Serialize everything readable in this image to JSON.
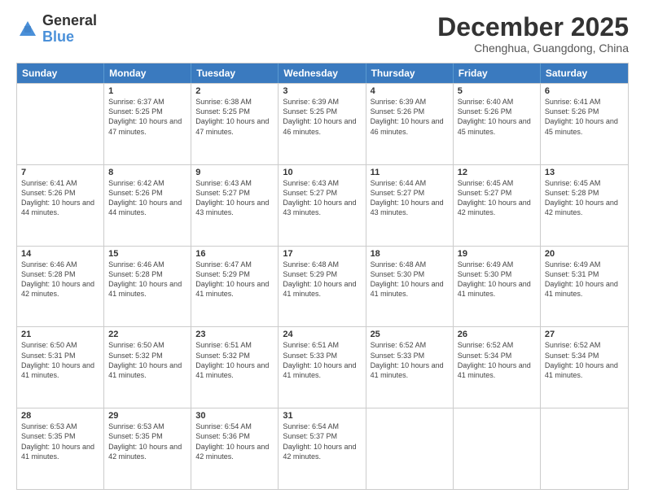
{
  "logo": {
    "general": "General",
    "blue": "Blue"
  },
  "title": "December 2025",
  "subtitle": "Chenghua, Guangdong, China",
  "header_days": [
    "Sunday",
    "Monday",
    "Tuesday",
    "Wednesday",
    "Thursday",
    "Friday",
    "Saturday"
  ],
  "weeks": [
    [
      {
        "day": "",
        "info": ""
      },
      {
        "day": "1",
        "info": "Sunrise: 6:37 AM\nSunset: 5:25 PM\nDaylight: 10 hours and 47 minutes."
      },
      {
        "day": "2",
        "info": "Sunrise: 6:38 AM\nSunset: 5:25 PM\nDaylight: 10 hours and 47 minutes."
      },
      {
        "day": "3",
        "info": "Sunrise: 6:39 AM\nSunset: 5:25 PM\nDaylight: 10 hours and 46 minutes."
      },
      {
        "day": "4",
        "info": "Sunrise: 6:39 AM\nSunset: 5:26 PM\nDaylight: 10 hours and 46 minutes."
      },
      {
        "day": "5",
        "info": "Sunrise: 6:40 AM\nSunset: 5:26 PM\nDaylight: 10 hours and 45 minutes."
      },
      {
        "day": "6",
        "info": "Sunrise: 6:41 AM\nSunset: 5:26 PM\nDaylight: 10 hours and 45 minutes."
      }
    ],
    [
      {
        "day": "7",
        "info": "Sunrise: 6:41 AM\nSunset: 5:26 PM\nDaylight: 10 hours and 44 minutes."
      },
      {
        "day": "8",
        "info": "Sunrise: 6:42 AM\nSunset: 5:26 PM\nDaylight: 10 hours and 44 minutes."
      },
      {
        "day": "9",
        "info": "Sunrise: 6:43 AM\nSunset: 5:27 PM\nDaylight: 10 hours and 43 minutes."
      },
      {
        "day": "10",
        "info": "Sunrise: 6:43 AM\nSunset: 5:27 PM\nDaylight: 10 hours and 43 minutes."
      },
      {
        "day": "11",
        "info": "Sunrise: 6:44 AM\nSunset: 5:27 PM\nDaylight: 10 hours and 43 minutes."
      },
      {
        "day": "12",
        "info": "Sunrise: 6:45 AM\nSunset: 5:27 PM\nDaylight: 10 hours and 42 minutes."
      },
      {
        "day": "13",
        "info": "Sunrise: 6:45 AM\nSunset: 5:28 PM\nDaylight: 10 hours and 42 minutes."
      }
    ],
    [
      {
        "day": "14",
        "info": "Sunrise: 6:46 AM\nSunset: 5:28 PM\nDaylight: 10 hours and 42 minutes."
      },
      {
        "day": "15",
        "info": "Sunrise: 6:46 AM\nSunset: 5:28 PM\nDaylight: 10 hours and 41 minutes."
      },
      {
        "day": "16",
        "info": "Sunrise: 6:47 AM\nSunset: 5:29 PM\nDaylight: 10 hours and 41 minutes."
      },
      {
        "day": "17",
        "info": "Sunrise: 6:48 AM\nSunset: 5:29 PM\nDaylight: 10 hours and 41 minutes."
      },
      {
        "day": "18",
        "info": "Sunrise: 6:48 AM\nSunset: 5:30 PM\nDaylight: 10 hours and 41 minutes."
      },
      {
        "day": "19",
        "info": "Sunrise: 6:49 AM\nSunset: 5:30 PM\nDaylight: 10 hours and 41 minutes."
      },
      {
        "day": "20",
        "info": "Sunrise: 6:49 AM\nSunset: 5:31 PM\nDaylight: 10 hours and 41 minutes."
      }
    ],
    [
      {
        "day": "21",
        "info": "Sunrise: 6:50 AM\nSunset: 5:31 PM\nDaylight: 10 hours and 41 minutes."
      },
      {
        "day": "22",
        "info": "Sunrise: 6:50 AM\nSunset: 5:32 PM\nDaylight: 10 hours and 41 minutes."
      },
      {
        "day": "23",
        "info": "Sunrise: 6:51 AM\nSunset: 5:32 PM\nDaylight: 10 hours and 41 minutes."
      },
      {
        "day": "24",
        "info": "Sunrise: 6:51 AM\nSunset: 5:33 PM\nDaylight: 10 hours and 41 minutes."
      },
      {
        "day": "25",
        "info": "Sunrise: 6:52 AM\nSunset: 5:33 PM\nDaylight: 10 hours and 41 minutes."
      },
      {
        "day": "26",
        "info": "Sunrise: 6:52 AM\nSunset: 5:34 PM\nDaylight: 10 hours and 41 minutes."
      },
      {
        "day": "27",
        "info": "Sunrise: 6:52 AM\nSunset: 5:34 PM\nDaylight: 10 hours and 41 minutes."
      }
    ],
    [
      {
        "day": "28",
        "info": "Sunrise: 6:53 AM\nSunset: 5:35 PM\nDaylight: 10 hours and 41 minutes."
      },
      {
        "day": "29",
        "info": "Sunrise: 6:53 AM\nSunset: 5:35 PM\nDaylight: 10 hours and 42 minutes."
      },
      {
        "day": "30",
        "info": "Sunrise: 6:54 AM\nSunset: 5:36 PM\nDaylight: 10 hours and 42 minutes."
      },
      {
        "day": "31",
        "info": "Sunrise: 6:54 AM\nSunset: 5:37 PM\nDaylight: 10 hours and 42 minutes."
      },
      {
        "day": "",
        "info": ""
      },
      {
        "day": "",
        "info": ""
      },
      {
        "day": "",
        "info": ""
      }
    ]
  ]
}
